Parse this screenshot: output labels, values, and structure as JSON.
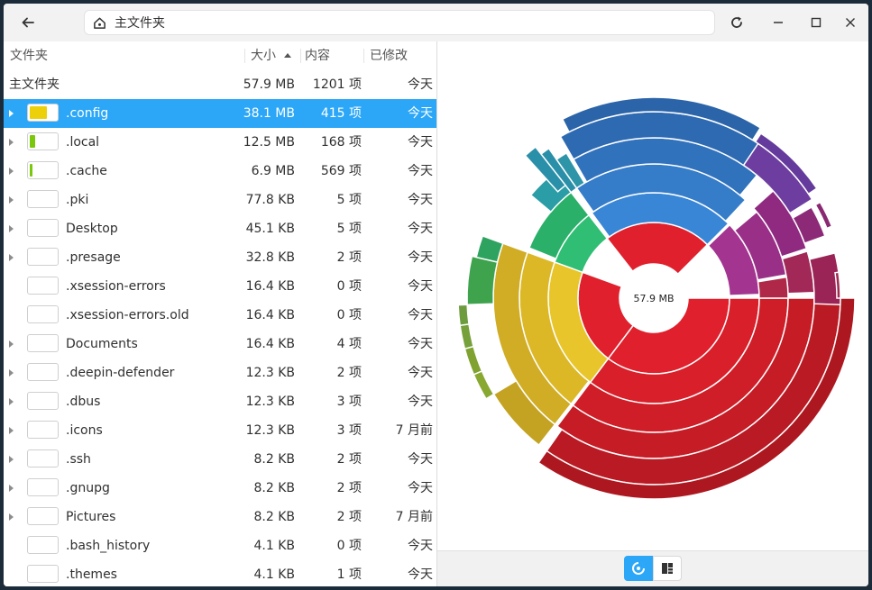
{
  "window": {
    "path_label": "主文件夹"
  },
  "columns": {
    "name": "文件夹",
    "size": "大小",
    "count": "内容",
    "modified": "已修改"
  },
  "root_row": {
    "name": "主文件夹",
    "size": "57.9 MB",
    "count": "1201 项",
    "modified": "今天"
  },
  "rows": [
    {
      "name": ".config",
      "size": "38.1 MB",
      "count": "415 项",
      "modified": "今天",
      "expandable": true,
      "selected": true,
      "fraction": 0.658,
      "color": "#ecd10a"
    },
    {
      "name": ".local",
      "size": "12.5 MB",
      "count": "168 项",
      "modified": "今天",
      "expandable": true,
      "fraction": 0.216,
      "color": "#7ac70c"
    },
    {
      "name": ".cache",
      "size": "6.9 MB",
      "count": "569 项",
      "modified": "今天",
      "expandable": true,
      "fraction": 0.119,
      "color": "#7ac70c"
    },
    {
      "name": ".pki",
      "size": "77.8 KB",
      "count": "5 项",
      "modified": "今天",
      "expandable": true,
      "fraction": 0.001,
      "color": "#7ac70c"
    },
    {
      "name": "Desktop",
      "size": "45.1 KB",
      "count": "5 项",
      "modified": "今天",
      "expandable": true,
      "fraction": 0.001,
      "color": "#7ac70c"
    },
    {
      "name": ".presage",
      "size": "32.8 KB",
      "count": "2 项",
      "modified": "今天",
      "expandable": true,
      "fraction": 0.0005,
      "color": "#7ac70c"
    },
    {
      "name": ".xsession-errors",
      "size": "16.4 KB",
      "count": "0 项",
      "modified": "今天",
      "expandable": false,
      "fraction": 0.0003,
      "color": "#7ac70c"
    },
    {
      "name": ".xsession-errors.old",
      "size": "16.4 KB",
      "count": "0 项",
      "modified": "今天",
      "expandable": false,
      "fraction": 0.0003,
      "color": "#7ac70c"
    },
    {
      "name": "Documents",
      "size": "16.4 KB",
      "count": "4 项",
      "modified": "今天",
      "expandable": true,
      "fraction": 0.0003,
      "color": "#7ac70c"
    },
    {
      "name": ".deepin-defender",
      "size": "12.3 KB",
      "count": "2 项",
      "modified": "今天",
      "expandable": true,
      "fraction": 0.0002,
      "color": "#7ac70c"
    },
    {
      "name": ".dbus",
      "size": "12.3 KB",
      "count": "3 项",
      "modified": "今天",
      "expandable": true,
      "fraction": 0.0002,
      "color": "#7ac70c"
    },
    {
      "name": ".icons",
      "size": "12.3 KB",
      "count": "3 项",
      "modified": "7 月前",
      "expandable": true,
      "fraction": 0.0002,
      "color": "#7ac70c"
    },
    {
      "name": ".ssh",
      "size": "8.2 KB",
      "count": "2 项",
      "modified": "今天",
      "expandable": true,
      "fraction": 0.0001,
      "color": "#7ac70c"
    },
    {
      "name": ".gnupg",
      "size": "8.2 KB",
      "count": "2 项",
      "modified": "今天",
      "expandable": true,
      "fraction": 0.0001,
      "color": "#7ac70c"
    },
    {
      "name": "Pictures",
      "size": "8.2 KB",
      "count": "2 项",
      "modified": "7 月前",
      "expandable": true,
      "fraction": 0.0001,
      "color": "#7ac70c"
    },
    {
      "name": ".bash_history",
      "size": "4.1 KB",
      "count": "0 项",
      "modified": "今天",
      "expandable": false,
      "fraction": 0.0001,
      "color": "#7ac70c"
    },
    {
      "name": ".themes",
      "size": "4.1 KB",
      "count": "1 项",
      "modified": "今天",
      "expandable": false,
      "fraction": 0.0001,
      "color": "#7ac70c"
    }
  ],
  "chart": {
    "center_label": "57.9 MB"
  },
  "colors": {
    "accent": "#2ca7f8",
    "red": "#d8202a",
    "yellow": "#e8c52a",
    "green": "#2eb36e",
    "blue": "#3a86d6",
    "purple": "#a3348f"
  }
}
